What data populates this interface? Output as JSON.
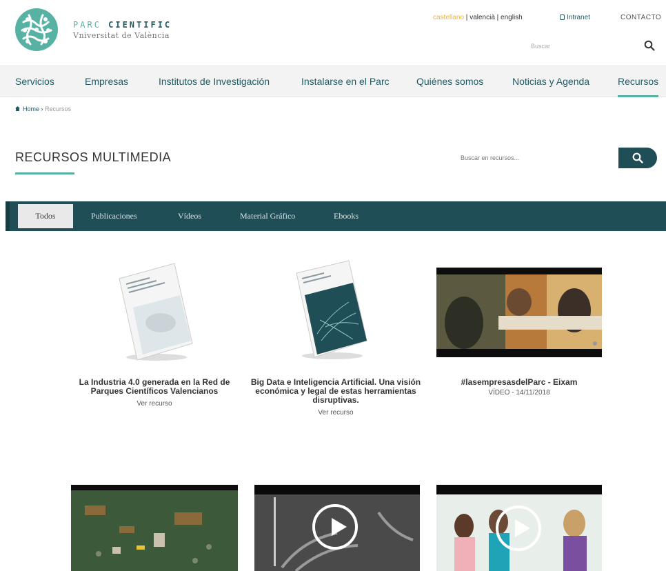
{
  "header": {
    "logo_line1_a": "PARC ",
    "logo_line1_b": "CIENTIFIC",
    "logo_line2": "Vniversitat de València",
    "lang_active": "castellano",
    "lang_sep1": " | ",
    "lang_valencia": "valencià",
    "lang_sep2": " | ",
    "lang_english": "english",
    "intranet": "Intranet",
    "contacto": "CONTACTO",
    "search_placeholder": "Buscar"
  },
  "nav": {
    "items": [
      "Servicios",
      "Empresas",
      "Institutos de Investigación",
      "Instalarse en el Parc",
      "Quiénes somos",
      "Noticias y Agenda",
      "Recursos"
    ]
  },
  "breadcrumb": {
    "home": "Home",
    "sep": " › ",
    "current": "Recursos"
  },
  "page": {
    "title": "RECURSOS MULTIMEDIA",
    "search_placeholder": "Buscar en recursos..."
  },
  "filters": [
    "Todos",
    "Publicaciones",
    "Vídeos",
    "Material Gráfico",
    "Ebooks"
  ],
  "cards": [
    {
      "title": "La Industria 4.0 generada en la Red de Parques Científicos Valencianos",
      "link": "Ver recurso"
    },
    {
      "title": "Big Data e Inteligencia Artificial. Una visión económica y legal de estas herramientas disruptivas.",
      "link": "Ver recurso"
    },
    {
      "title": "#lasempresasdelParc - Eixam",
      "sub": "VÍDEO - 14/11/2018"
    }
  ],
  "colors": {
    "teal": "#58b2a4",
    "dark_teal": "#1f4e56",
    "nav_text": "#1f5a62"
  }
}
